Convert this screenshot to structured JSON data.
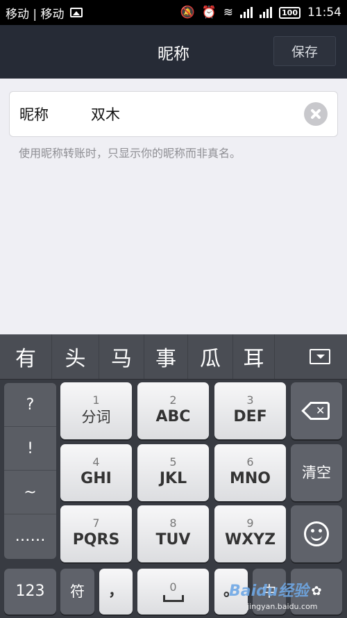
{
  "status_bar": {
    "carrier": "移动 | 移动",
    "battery": "100",
    "time": "11:54"
  },
  "header": {
    "title": "昵称",
    "save_label": "保存"
  },
  "form": {
    "label": "昵称",
    "value": "双木",
    "hint": "使用昵称转账时，只显示你的昵称而非真名。"
  },
  "keyboard": {
    "candidates": [
      "有",
      "头",
      "马",
      "事",
      "瓜",
      "耳"
    ],
    "symbols": [
      "?",
      "!",
      "~",
      "……"
    ],
    "keys": [
      {
        "num": "1",
        "label": "分词"
      },
      {
        "num": "2",
        "label": "ABC"
      },
      {
        "num": "3",
        "label": "DEF"
      },
      {
        "num": "4",
        "label": "GHI"
      },
      {
        "num": "5",
        "label": "JKL"
      },
      {
        "num": "6",
        "label": "MNO"
      },
      {
        "num": "7",
        "label": "PQRS"
      },
      {
        "num": "8",
        "label": "TUV"
      },
      {
        "num": "9",
        "label": "WXYZ"
      }
    ],
    "clear_label": "清空",
    "num_mode_label": "123",
    "symbol_label": "符",
    "comma_label": "，",
    "space_num": "0",
    "lang_label": "中"
  },
  "watermark": {
    "text": "Baidu经验",
    "url": "jingyan.baidu.com"
  },
  "icons": {
    "clear": "clear-circle-icon",
    "backspace": "backspace-icon",
    "emoji": "smile-icon",
    "collapse": "keyboard-collapse-icon"
  }
}
